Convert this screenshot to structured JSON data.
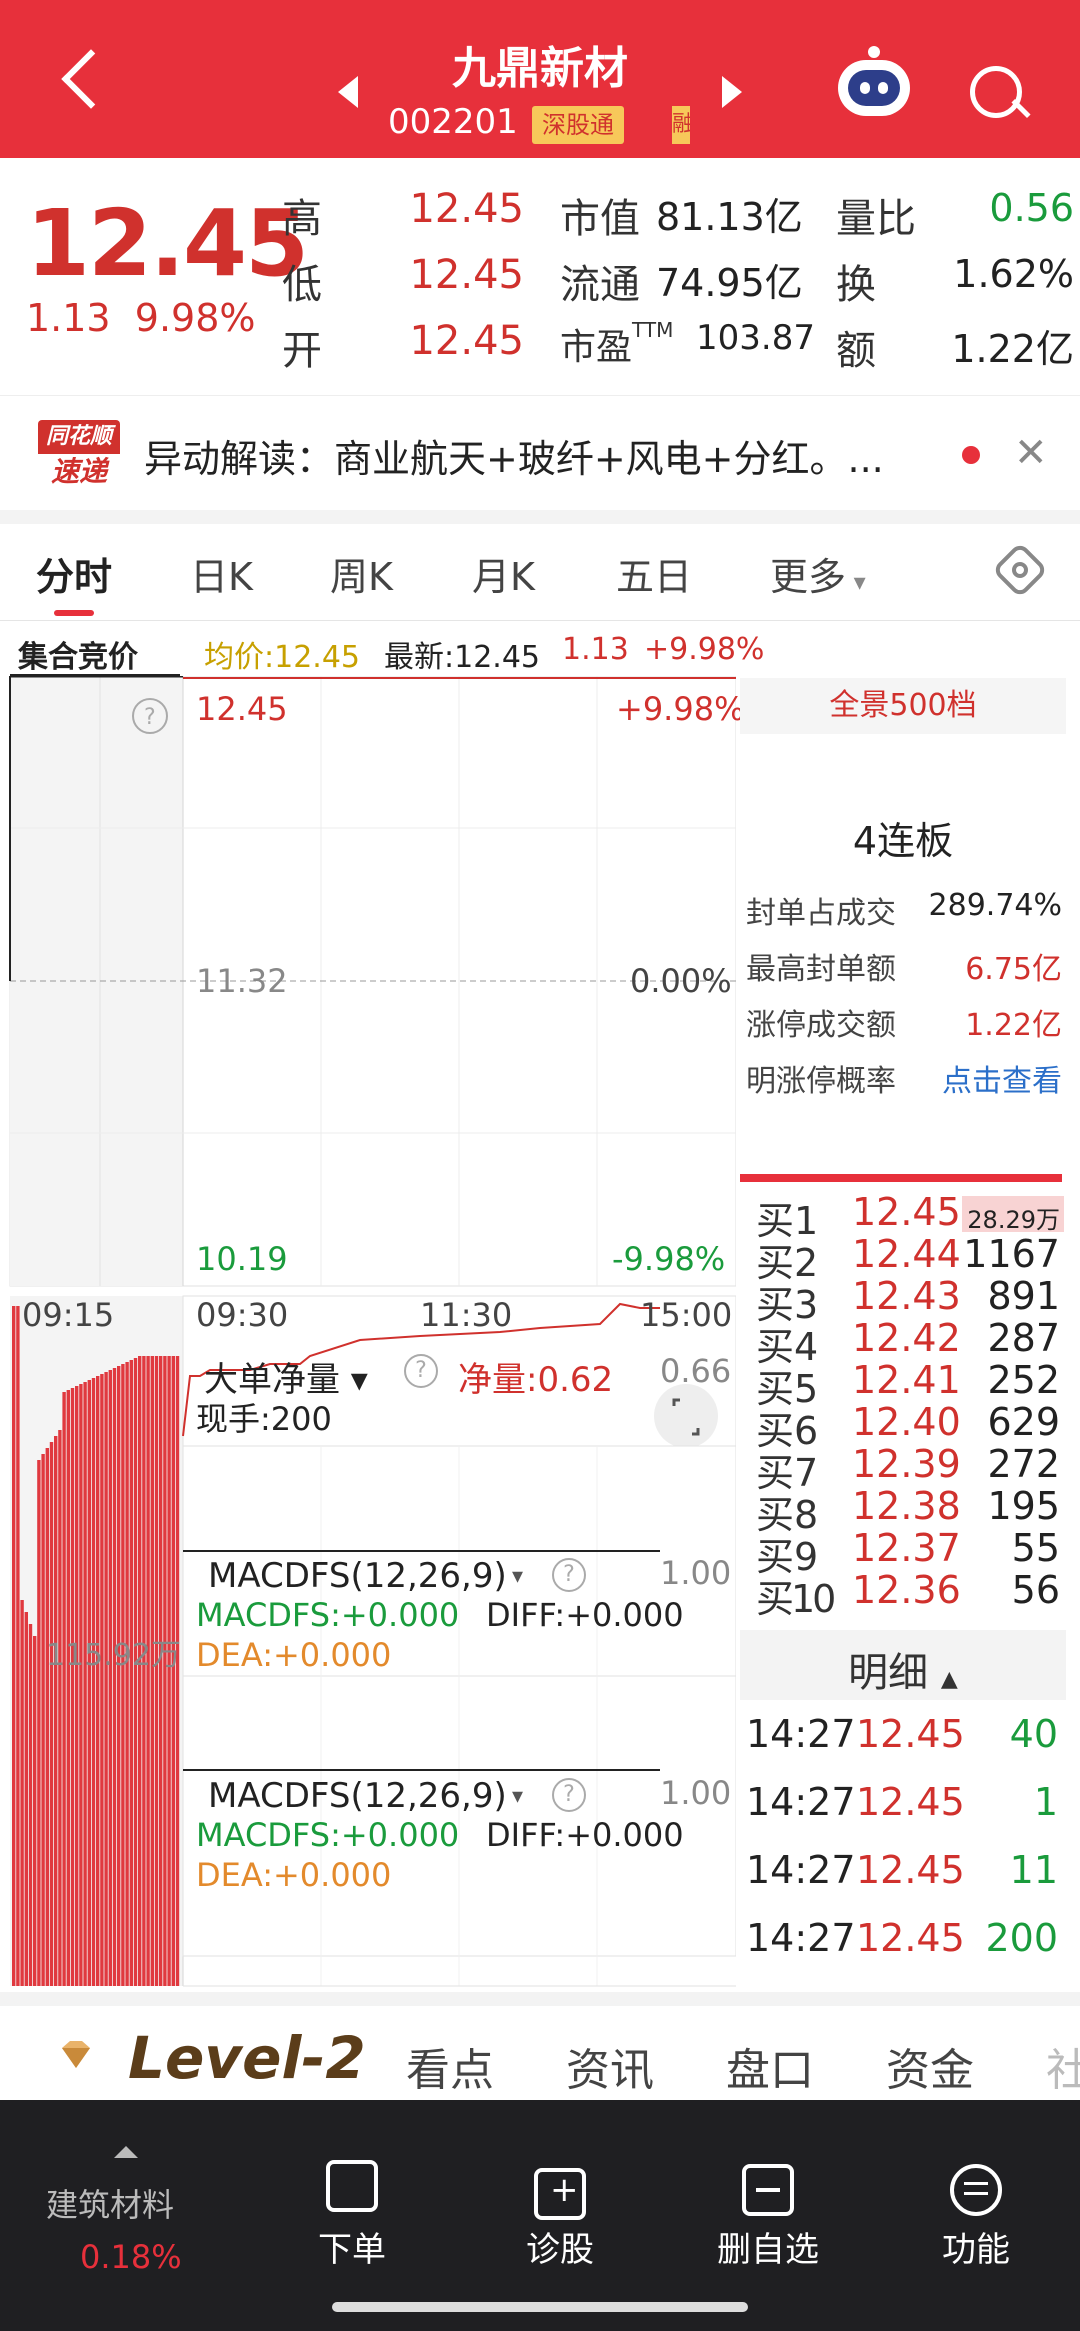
{
  "header": {
    "title": "九鼎新材",
    "code": "002201",
    "tag": "深股通",
    "tag2": "融"
  },
  "quote": {
    "price": "12.45",
    "change": "1.13",
    "change_pct": "9.98%",
    "rows": [
      {
        "label": "高",
        "value": "12.45",
        "mlabel": "市值",
        "mvalue": "81.13亿",
        "rlabel": "量比",
        "rvalue": "0.56"
      },
      {
        "label": "低",
        "value": "12.45",
        "mlabel": "流通",
        "mvalue": "74.95亿",
        "rlabel": "换",
        "rvalue": "1.62%"
      },
      {
        "label": "开",
        "value": "12.45",
        "mlabel": "市盈TTM",
        "mvalue": "103.87",
        "rlabel": "额",
        "rvalue": "1.22亿"
      }
    ]
  },
  "news": {
    "logo_top": "同花顺",
    "logo_bottom": "速递",
    "text": "异动解读：商业航天+玻纤+风电+分红。..."
  },
  "tabs": [
    "分时",
    "日K",
    "周K",
    "月K",
    "五日",
    "更多"
  ],
  "infobar": {
    "auction": "集合竞价",
    "avg": "均价:12.45",
    "latest": "最新:12.45",
    "chg": "1.13",
    "pct": "+9.98%"
  },
  "chart": {
    "price_high": "12.45",
    "price_mid": "11.32",
    "price_low": "10.19",
    "pct_high": "+9.98%",
    "pct_mid": "0.00%",
    "pct_low": "-9.98%",
    "times": [
      "09:15",
      "09:30",
      "11:30",
      "15:00"
    ],
    "auction_vol": "115.92万",
    "big_order_label": "大单净量",
    "big_order_net": "净量:0.62",
    "big_order_axis": "0.66",
    "hand": "现手:200",
    "macd_panels": [
      {
        "title": "MACDFS(12,26,9)",
        "macdfs": "MACDFS:+0.000",
        "diff": "DIFF:+0.000",
        "dea": "DEA:+0.000",
        "axis": "1.00"
      },
      {
        "title": "MACDFS(12,26,9)",
        "macdfs": "MACDFS:+0.000",
        "diff": "DIFF:+0.000",
        "dea": "DEA:+0.000",
        "axis": "1.00"
      }
    ]
  },
  "right_panel": {
    "title": "全景500档",
    "lianban": "4连板",
    "stats": [
      {
        "k": "封单占成交",
        "v": "289.74%",
        "color": "#222222"
      },
      {
        "k": "最高封单额",
        "v": "6.75亿",
        "color": "#d0312d"
      },
      {
        "k": "涨停成交额",
        "v": "1.22亿",
        "color": "#d0312d"
      },
      {
        "k": "明涨停概率",
        "v": "点击查看",
        "color": "#2b6fc9"
      }
    ],
    "buys": [
      {
        "label": "买1",
        "price": "12.45",
        "vol": "28.29万"
      },
      {
        "label": "买2",
        "price": "12.44",
        "vol": "1167"
      },
      {
        "label": "买3",
        "price": "12.43",
        "vol": "891"
      },
      {
        "label": "买4",
        "price": "12.42",
        "vol": "287"
      },
      {
        "label": "买5",
        "price": "12.41",
        "vol": "252"
      },
      {
        "label": "买6",
        "price": "12.40",
        "vol": "629"
      },
      {
        "label": "买7",
        "price": "12.39",
        "vol": "272"
      },
      {
        "label": "买8",
        "price": "12.38",
        "vol": "195"
      },
      {
        "label": "买9",
        "price": "12.37",
        "vol": "55"
      },
      {
        "label": "买10",
        "price": "12.36",
        "vol": "56"
      }
    ],
    "mingxi": "明细",
    "ticks": [
      {
        "time": "14:27",
        "price": "12.45",
        "vol": "40"
      },
      {
        "time": "14:27",
        "price": "12.45",
        "vol": "1"
      },
      {
        "time": "14:27",
        "price": "12.45",
        "vol": "11"
      },
      {
        "time": "14:27",
        "price": "12.45",
        "vol": "200"
      }
    ]
  },
  "bottom_tabs": [
    "Level-2",
    "看点",
    "资讯",
    "盘口",
    "资金",
    "社"
  ],
  "bottom_nav": {
    "sector": "建筑材料",
    "sector_pct": "0.18%",
    "items": [
      "下单",
      "诊股",
      "删自选",
      "功能"
    ]
  },
  "colors": {
    "accent": "#e7303b",
    "up": "#d0312d",
    "down": "#1a9b3c"
  }
}
